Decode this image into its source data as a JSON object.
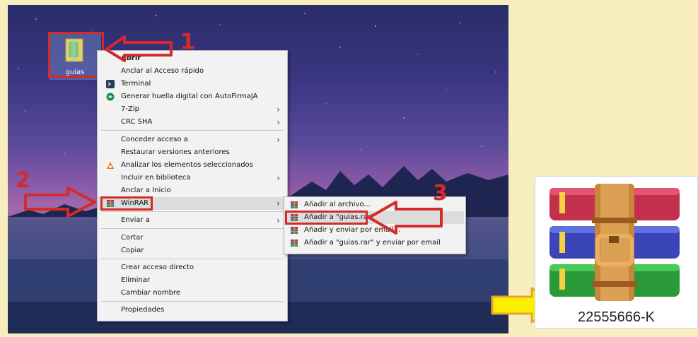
{
  "desktop": {
    "folder": {
      "label": "guias"
    }
  },
  "context_menu": {
    "items": [
      {
        "label": "Abrir",
        "bold": true
      },
      {
        "label": "Anclar al Acceso rápido"
      },
      {
        "label": "Terminal",
        "icon": "terminal-icon"
      },
      {
        "label": "Generar huella digital con AutoFirmaJA",
        "icon": "autofirma-icon"
      },
      {
        "label": "7-Zip",
        "submenu": true
      },
      {
        "label": "CRC SHA",
        "submenu": true
      },
      {
        "label": "Conceder acceso a",
        "submenu": true
      },
      {
        "label": "Restaurar versiones anteriores"
      },
      {
        "label": "Analizar los elementos seleccionados",
        "icon": "avast-icon"
      },
      {
        "label": "Incluir en biblioteca",
        "submenu": true
      },
      {
        "label": "Anclar a Inicio"
      },
      {
        "label": "WinRAR",
        "icon": "winrar-icon",
        "submenu": true
      },
      {
        "label": "Enviar a",
        "submenu": true
      },
      {
        "label": "Cortar"
      },
      {
        "label": "Copiar"
      },
      {
        "label": "Crear acceso directo"
      },
      {
        "label": "Eliminar"
      },
      {
        "label": "Cambiar nombre"
      },
      {
        "label": "Propiedades"
      }
    ]
  },
  "winrar_submenu": {
    "items": [
      {
        "label": "Añadir al archivo...",
        "icon": "winrar-icon"
      },
      {
        "label": "Añadir a \"guias.rar\"",
        "icon": "winrar-icon"
      },
      {
        "label": "Añadir y enviar por email...",
        "icon": "winrar-icon"
      },
      {
        "label": "Añadir a \"guias.rar\" y enviar por email",
        "icon": "winrar-icon"
      }
    ]
  },
  "annotations": {
    "step1": "1",
    "step2": "2",
    "step3": "3",
    "red": "#d62a2a",
    "yellow": "#f8f000",
    "orange": "#f0a030"
  },
  "winrar_card": {
    "icon": "winrar-books-icon",
    "caption": "22555666-K"
  }
}
